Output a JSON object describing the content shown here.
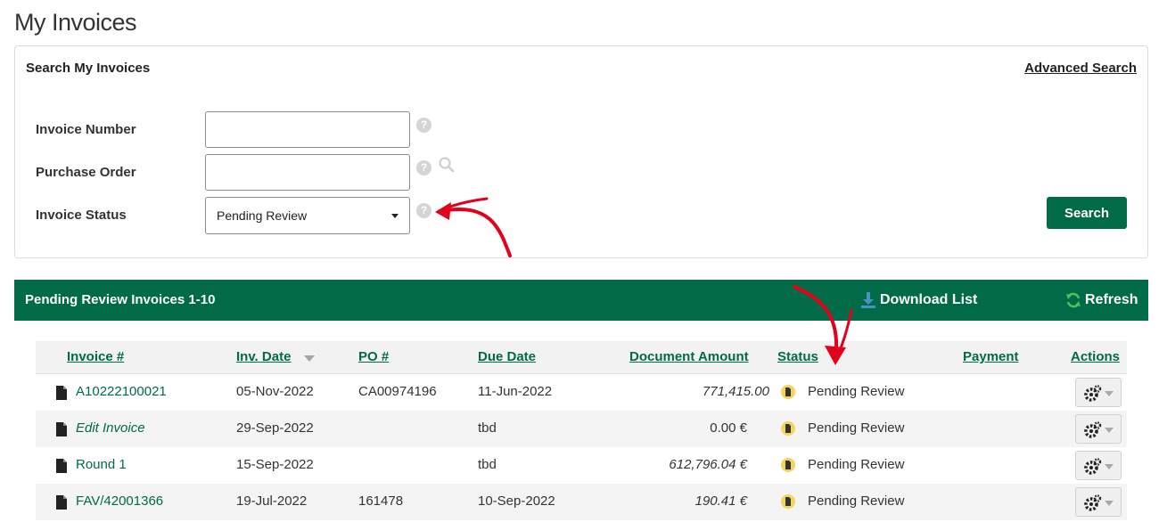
{
  "page": {
    "title": "My Invoices"
  },
  "search": {
    "title": "Search My Invoices",
    "advanced_link": "Advanced Search",
    "fields": {
      "invoice_number": {
        "label": "Invoice Number",
        "value": "",
        "placeholder": ""
      },
      "purchase_order": {
        "label": "Purchase Order",
        "value": "",
        "placeholder": ""
      },
      "invoice_status": {
        "label": "Invoice Status",
        "selected": "Pending Review"
      }
    },
    "button_label": "Search",
    "help_glyph": "?"
  },
  "results": {
    "title": "Pending Review Invoices 1-10",
    "download_label": "Download List",
    "refresh_label": "Refresh",
    "columns": {
      "invoice": "Invoice #",
      "inv_date": "Inv. Date",
      "po": "PO #",
      "due_date": "Due Date",
      "amount": "Document Amount",
      "status": "Status",
      "payment": "Payment",
      "actions": "Actions"
    },
    "rows": [
      {
        "invoice": "A10222100021",
        "inv_date": "05-Nov-2022",
        "po": "CA00974196",
        "due_date": "11-Jun-2022",
        "amount": "771,415.00",
        "status": "Pending Review",
        "payment": ""
      },
      {
        "invoice": "Edit Invoice",
        "inv_date": "29-Sep-2022",
        "po": "",
        "due_date": "tbd",
        "amount": "0.00 €",
        "status": "Pending Review",
        "payment": ""
      },
      {
        "invoice": "Round 1",
        "inv_date": "15-Sep-2022",
        "po": "",
        "due_date": "tbd",
        "amount": "612,796.04 €",
        "status": "Pending Review",
        "payment": ""
      },
      {
        "invoice": "FAV/42001366",
        "inv_date": "19-Jul-2022",
        "po": "161478",
        "due_date": "10-Sep-2022",
        "amount": "190.41 €",
        "status": "Pending Review",
        "payment": ""
      }
    ]
  },
  "icons": {
    "help": "question-circle-icon",
    "lookup": "magnifier-icon",
    "download": "download-arrow-icon",
    "refresh": "circular-arrows-icon",
    "document": "document-icon",
    "status": "pending-status-icon",
    "actions": "gear-icon"
  },
  "colors": {
    "brand_green": "#006b46",
    "status_yellow": "#f3d55b",
    "annotation_red": "#e3001b",
    "download_blue": "#4a90c8",
    "refresh_green": "#4cc35a"
  }
}
